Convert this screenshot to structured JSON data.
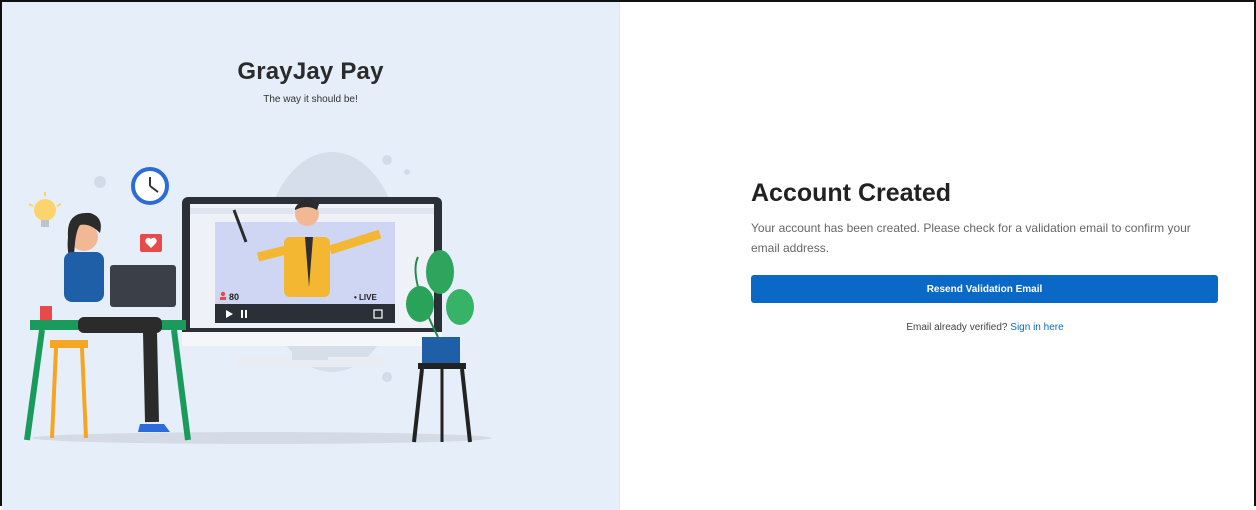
{
  "brand": {
    "title": "GrayJay Pay",
    "tagline": "The way it should be!"
  },
  "illustration": {
    "viewer_count": "80",
    "live_label": "• LIVE"
  },
  "card": {
    "heading": "Account Created",
    "message": "Your account has been created. Please check for a validation email to confirm your email address.",
    "resend_button": "Resend Validation Email",
    "verified_prompt": "Email already verified?",
    "signin_link": "Sign in here"
  },
  "colors": {
    "accent": "#0a69c6",
    "panel_bg": "#e6eff9"
  },
  "icons": [
    "lightbulb-icon",
    "clock-icon",
    "heart-icon",
    "person-icon",
    "play-icon",
    "pause-icon",
    "fullscreen-icon"
  ]
}
